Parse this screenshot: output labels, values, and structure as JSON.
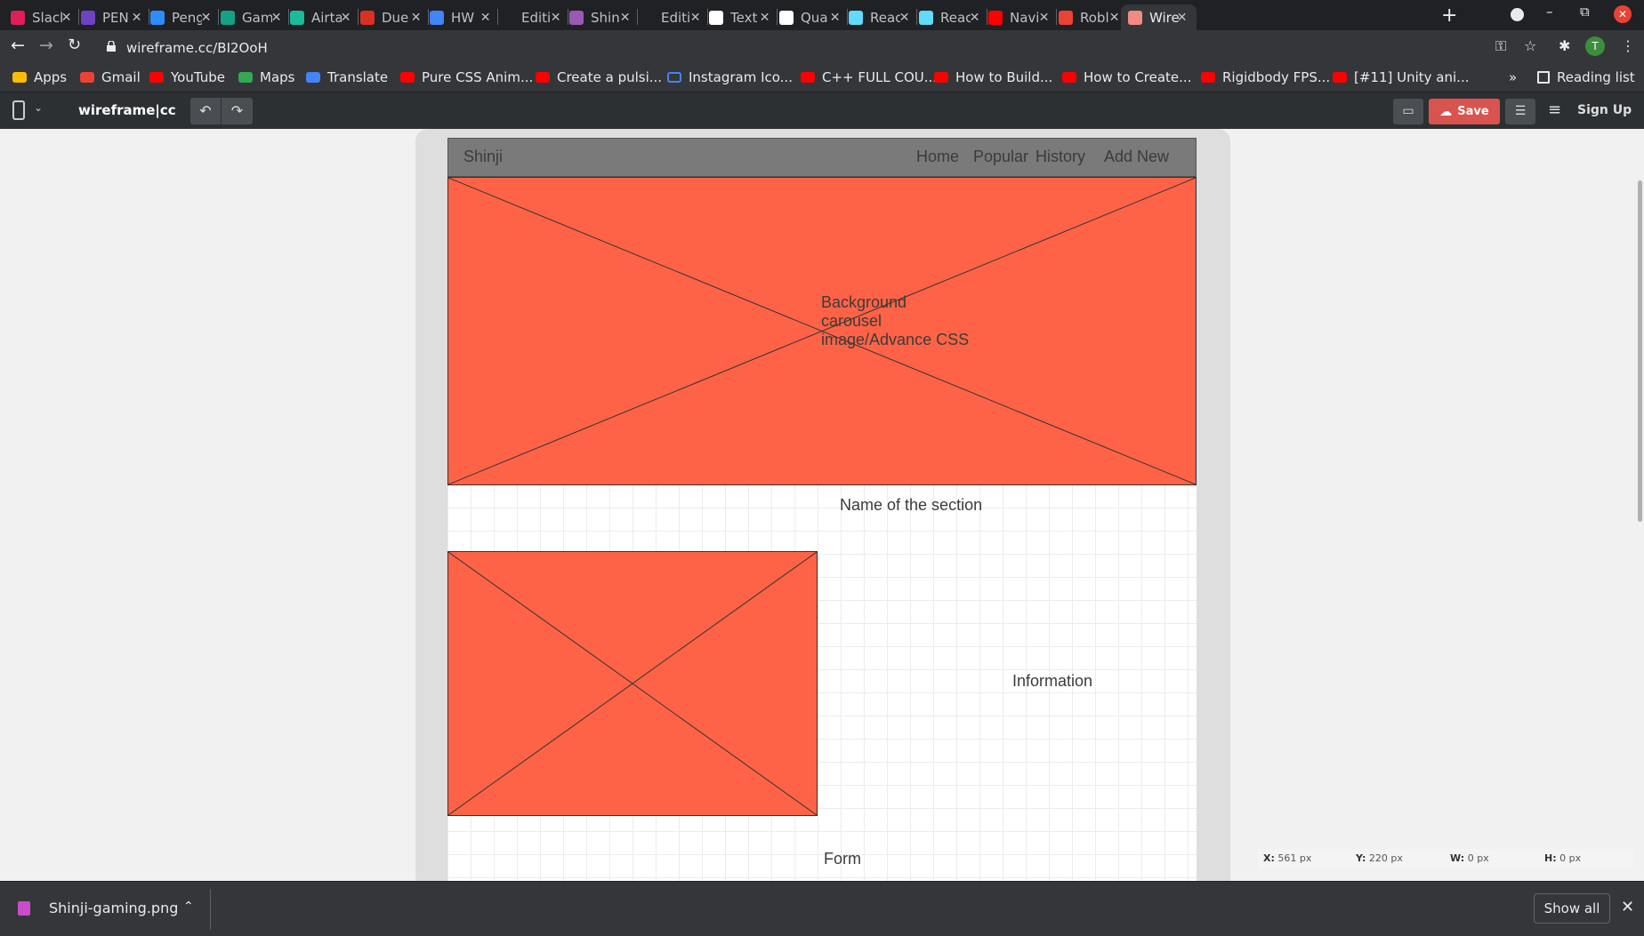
{
  "browser": {
    "tabs": [
      {
        "title": "Slack",
        "color": "#e01e5a",
        "active": false
      },
      {
        "title": "PEN",
        "color": "#6f42c1",
        "active": false
      },
      {
        "title": "Peng",
        "color": "#2d8cff",
        "active": false
      },
      {
        "title": "Gam",
        "color": "#16a085",
        "active": false
      },
      {
        "title": "Airta",
        "color": "#1abc9c",
        "active": false
      },
      {
        "title": "Due",
        "color": "#d93025",
        "active": false
      },
      {
        "title": "HW",
        "color": "#4285f4",
        "active": false
      },
      {
        "title": "Editi",
        "color": "#202124",
        "active": false
      },
      {
        "title": "Shin",
        "color": "#9b59b6",
        "active": false
      },
      {
        "title": "Editi",
        "color": "#202124",
        "active": false
      },
      {
        "title": "Text",
        "color": "#ffffff",
        "active": false
      },
      {
        "title": "Qua",
        "color": "#ffffff",
        "active": false
      },
      {
        "title": "Reac",
        "color": "#61dafb",
        "active": false
      },
      {
        "title": "Reac",
        "color": "#61dafb",
        "active": false
      },
      {
        "title": "Navi",
        "color": "#ff0000",
        "active": false
      },
      {
        "title": "Robl",
        "color": "#ea4335",
        "active": false
      },
      {
        "title": "Wire",
        "color": "#f28b82",
        "active": true
      }
    ],
    "url": "wireframe.cc/BI2OoH",
    "avatar_letter": "T",
    "bookmarks": [
      {
        "label": "Apps",
        "type": "apps"
      },
      {
        "label": "Gmail",
        "type": "gmail"
      },
      {
        "label": "YouTube",
        "type": "yt"
      },
      {
        "label": "Maps",
        "type": "maps"
      },
      {
        "label": "Translate",
        "type": "translate"
      },
      {
        "label": "Pure CSS Anim...",
        "type": "yt"
      },
      {
        "label": "Create a pulsi...",
        "type": "yt"
      },
      {
        "label": "Instagram Ico...",
        "type": "flag"
      },
      {
        "label": "C++ FULL COU...",
        "type": "yt"
      },
      {
        "label": "How to Build...",
        "type": "yt"
      },
      {
        "label": "How to Create...",
        "type": "yt"
      },
      {
        "label": "Rigidbody FPS...",
        "type": "yt"
      },
      {
        "label": "[#11] Unity ani...",
        "type": "yt"
      }
    ],
    "more_bookmarks": "»",
    "reading_list": "Reading list"
  },
  "app": {
    "logo": "wireframe|cc",
    "save_label": "Save",
    "signup_label": "Sign Up"
  },
  "wireframe": {
    "brand": "Shinji",
    "nav_links": [
      "Home",
      "Popular",
      "History",
      "Add New"
    ],
    "hero_text": "Background\ncarousel\nimage/Advance CSS",
    "section_title": "Name of the section",
    "information_text": "Information",
    "form_text": "Form"
  },
  "coords": {
    "x": "561 px",
    "y": "220 px",
    "w": "0 px",
    "h": "0 px"
  },
  "download": {
    "filename": "Shinji-gaming.png",
    "show_all": "Show all"
  }
}
